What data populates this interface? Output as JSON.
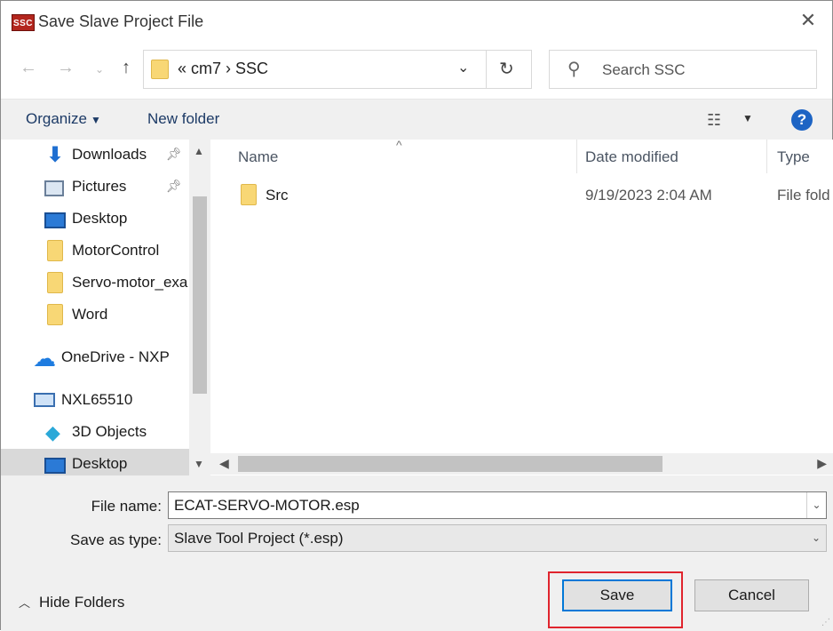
{
  "window": {
    "title": "Save Slave Project File",
    "app_icon_text": "SSC",
    "close_glyph": "✕"
  },
  "address": {
    "path_text": "«  cm7  ›  SSC",
    "search_placeholder": "Search SSC"
  },
  "toolbar": {
    "organize_label": "Organize",
    "new_folder_label": "New folder",
    "help_glyph": "?"
  },
  "nav_pane": {
    "items": [
      {
        "label": "Downloads",
        "icon": "download-arrow-icon",
        "pinned": true
      },
      {
        "label": "Pictures",
        "icon": "pictures-icon",
        "pinned": true
      },
      {
        "label": "Desktop",
        "icon": "desktop-icon"
      },
      {
        "label": "MotorControl",
        "icon": "folder-icon"
      },
      {
        "label": "Servo-motor_exa",
        "icon": "folder-icon"
      },
      {
        "label": "Word",
        "icon": "folder-icon"
      },
      {
        "label": "OneDrive - NXP",
        "icon": "onedrive-cloud-icon"
      },
      {
        "label": "NXL65510",
        "icon": "this-pc-icon"
      },
      {
        "label": "3D Objects",
        "icon": "3d-objects-icon"
      },
      {
        "label": "Desktop",
        "icon": "desktop-icon",
        "selected": true
      }
    ]
  },
  "file_list": {
    "columns": [
      "Name",
      "Date modified",
      "Type"
    ],
    "rows": [
      {
        "name": "Src",
        "date": "9/19/2023 2:04 AM",
        "type": "File fold"
      }
    ]
  },
  "form": {
    "file_name_label": "File name:",
    "file_name_value": "ECAT-SERVO-MOTOR.esp",
    "save_type_label": "Save as type:",
    "save_type_value": "Slave Tool Project  (*.esp)"
  },
  "footer": {
    "hide_folders_label": "Hide Folders",
    "save_label": "Save",
    "cancel_label": "Cancel"
  },
  "colors": {
    "accent": "#0078d7",
    "highlight_box": "#e0242d",
    "folder": "#f8d775",
    "help": "#1d64c4"
  }
}
